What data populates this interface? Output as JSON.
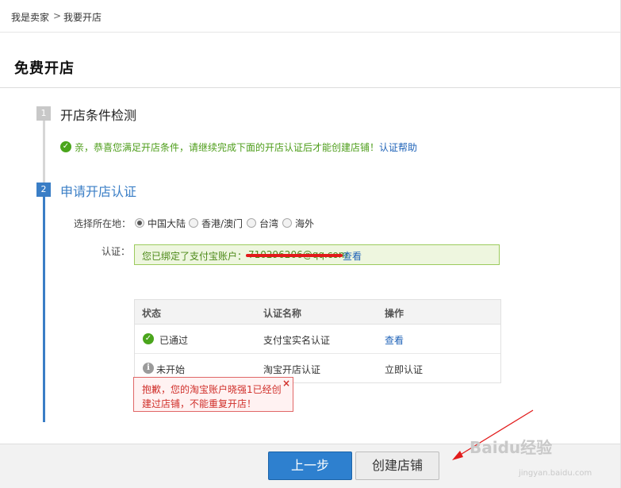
{
  "breadcrumb": {
    "parent": "我是卖家",
    "separator": ">",
    "current": "我要开店"
  },
  "page": {
    "title": "免费开店"
  },
  "step1": {
    "number": "1",
    "title": "开店条件检测",
    "notice": "亲，恭喜您满足开店条件，请继续完成下面的开店认证后才能创建店铺！",
    "help_link": "认证帮助"
  },
  "step2": {
    "number": "2",
    "title": "申请开店认证",
    "location_label": "选择所在地：",
    "locations": [
      "中国大陆",
      "香港/澳门",
      "台湾",
      "海外"
    ],
    "selected_location": "中国大陆",
    "auth_label": "认证：",
    "auth_text": "您已绑定了支付宝账户：",
    "auth_account": "710296206@qq.com",
    "auth_link": "查看"
  },
  "table": {
    "headers": [
      "状态",
      "认证名称",
      "操作"
    ],
    "rows": [
      {
        "status": "已通过",
        "name": "支付宝实名认证",
        "action": "查看"
      },
      {
        "status": "未开始",
        "name": "淘宝开店认证",
        "action": "立即认证"
      }
    ]
  },
  "error_tip": {
    "text": "抱歉，您的淘宝账户晓强1已经创建过店铺，不能重复开店！",
    "close": "×"
  },
  "buttons": {
    "prev": "上一步",
    "create": "创建店铺"
  },
  "watermark": {
    "brand": "Baidu经验",
    "url": "jingyan.baidu.com"
  },
  "colors": {
    "accent_blue": "#3a7ec6",
    "success_green": "#4aa51c",
    "error_red": "#d0302b",
    "arrow_red": "#e21b1b"
  }
}
